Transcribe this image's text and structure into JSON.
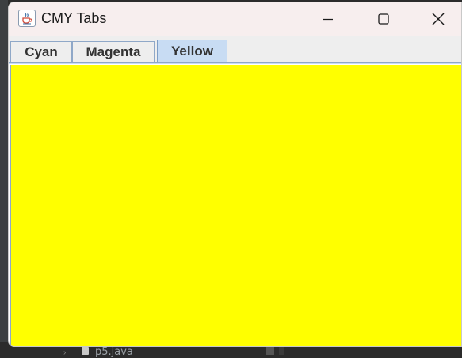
{
  "window": {
    "title": "CMY Tabs",
    "app_icon": "java-coffee-cup-icon"
  },
  "controls": {
    "minimize_icon": "minimize-icon",
    "maximize_icon": "maximize-icon",
    "close_icon": "close-icon"
  },
  "tabs": [
    {
      "label": "Cyan",
      "selected": false
    },
    {
      "label": "Magenta",
      "selected": false
    },
    {
      "label": "Yellow",
      "selected": true
    }
  ],
  "content": {
    "color": "#ffff00"
  },
  "background": {
    "file_label": "p5.java"
  }
}
